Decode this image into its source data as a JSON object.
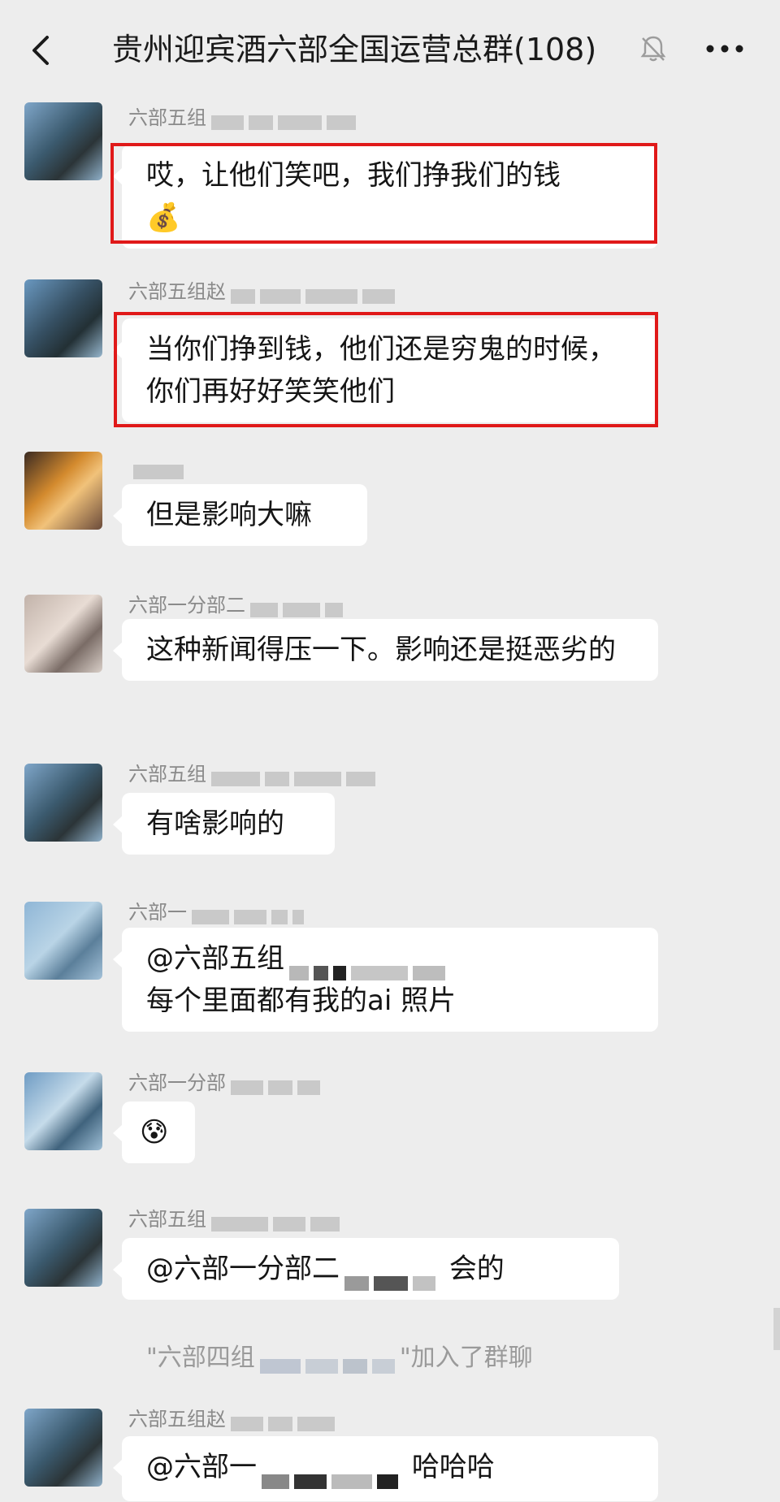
{
  "header": {
    "title": "贵州迎宾酒六部全国运营总群(108)",
    "back_icon": "chevron-left-icon",
    "mute_icon": "bell-off-icon",
    "more_icon": "more-dots-icon"
  },
  "messages": [
    {
      "sender": "六部五组",
      "text": "哎，让他们笑吧，我们挣我们的钱",
      "emoji": "💰",
      "highlighted": true
    },
    {
      "sender": "六部五组赵",
      "text": "当你们挣到钱，他们还是穷鬼的时候，你们再好好笑笑他们",
      "highlighted": true
    },
    {
      "sender": "",
      "text": "但是影响大嘛"
    },
    {
      "sender": "六部一分部二",
      "text": "这种新闻得压一下。影响还是挺恶劣的"
    },
    {
      "sender": "六部五组",
      "text": "有啥影响的"
    },
    {
      "sender": "六部一",
      "mention": "@六部五组",
      "text": "每个里面都有我的ai 照片"
    },
    {
      "sender": "六部一分部",
      "emoji": "😰"
    },
    {
      "sender": "六部五组",
      "mention": "@六部一分部二",
      "text": "会的"
    },
    {
      "sender": "六部五组赵",
      "mention": "@六部一",
      "text": "哈哈哈"
    }
  ],
  "system_notice": {
    "prefix": "\"六部四组",
    "suffix": "\"加入了群聊"
  },
  "colors": {
    "background": "#ededed",
    "bubble": "#ffffff",
    "highlight_border": "#e01919",
    "meta_text": "#8a8a8a"
  }
}
